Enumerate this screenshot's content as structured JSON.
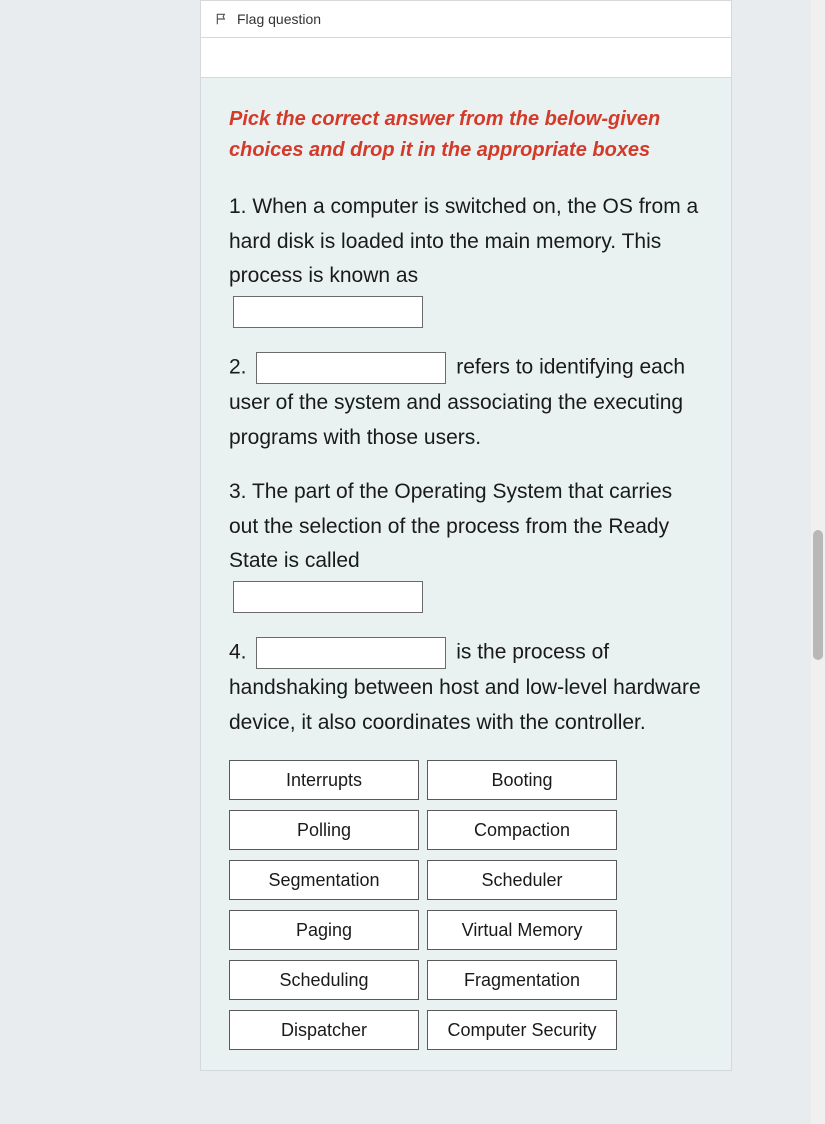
{
  "flag": {
    "label": "Flag question"
  },
  "instruction": "Pick the correct answer from the below-given choices and drop it in the appropriate boxes",
  "questions": {
    "q1_pre": "1.  When a computer is switched on,  the OS from a hard disk is loaded into the main memory. This process is known as ",
    "q2_pre": "2. ",
    "q2_post": " refers to identifying each user of the system and associating the executing programs with those users.",
    "q3_pre": "3. The part of the Operating System that carries out the selection of the process from the Ready State is called ",
    "q4_pre": "4. ",
    "q4_post": " is the process of handshaking between host and low-level hardware device, it also coordinates with the controller."
  },
  "choices": [
    "Interrupts",
    "Booting",
    "Polling",
    "Compaction",
    "Segmentation",
    "Scheduler",
    "Paging",
    "Virtual Memory",
    "Scheduling",
    "Fragmentation",
    "Dispatcher",
    "Computer Security"
  ]
}
